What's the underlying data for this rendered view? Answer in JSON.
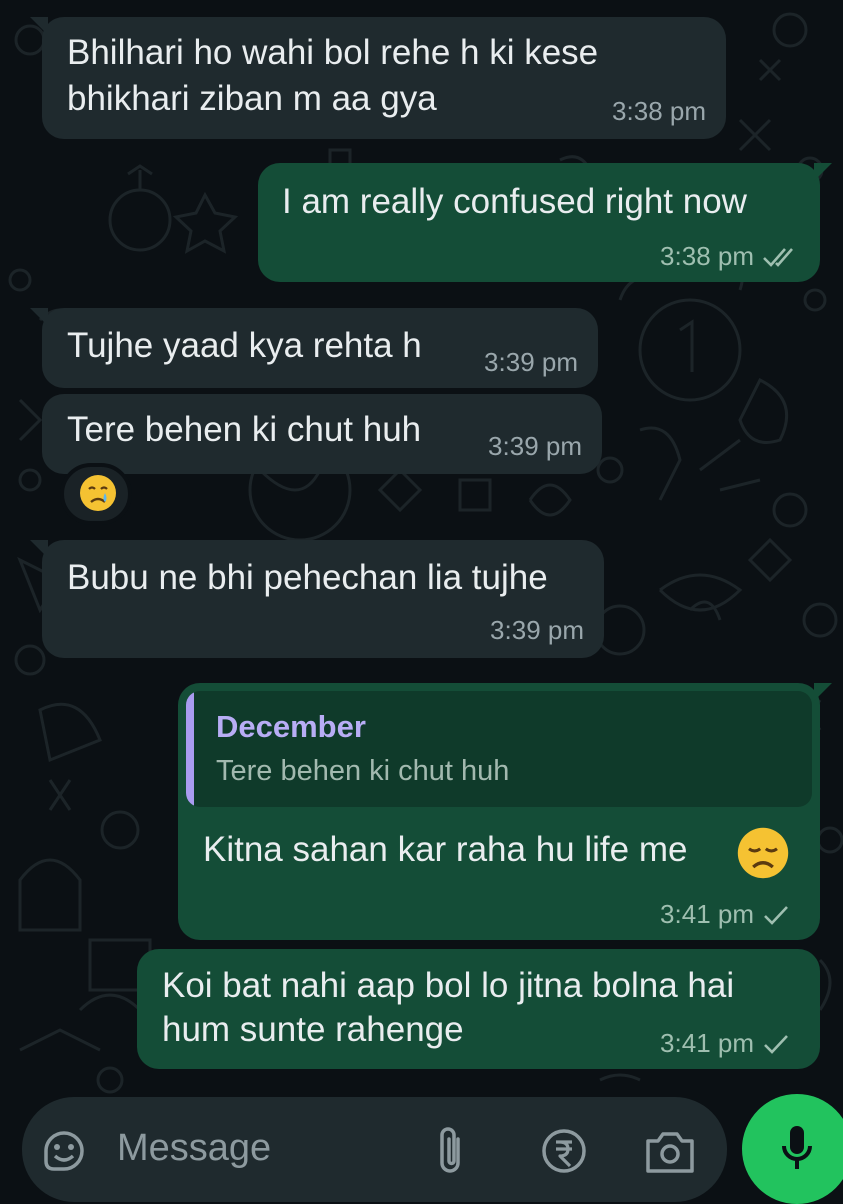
{
  "theme": {
    "bg": "#0b1014",
    "incoming_bubble": "#1f2a2e",
    "outgoing_bubble": "#144d37",
    "accent": "#22c35e",
    "quote_accent": "#a99cf0"
  },
  "messages": [
    {
      "direction": "incoming",
      "text_lines": [
        "Bhilhari ho wahi bol rehe h ki kese",
        "bhikhari ziban m aa gya"
      ],
      "time": "3:38 pm"
    },
    {
      "direction": "outgoing",
      "text": "I am really confused right now",
      "time": "3:38 pm",
      "status": "read"
    },
    {
      "direction": "incoming",
      "text": "Tujhe yaad kya rehta h",
      "time": "3:39 pm"
    },
    {
      "direction": "incoming",
      "text": "Tere behen ki chut huh",
      "time": "3:39 pm",
      "reaction": "crying-face-emoji"
    },
    {
      "direction": "incoming",
      "text": "Bubu ne bhi pehechan lia tujhe",
      "time": "3:39 pm"
    },
    {
      "direction": "outgoing",
      "reply_to": {
        "author": "December",
        "text": "Tere behen ki chut huh"
      },
      "text": "Kitna sahan kar raha hu life me",
      "emoji": "disappointed-face-emoji",
      "time": "3:41 pm",
      "status": "sent"
    },
    {
      "direction": "outgoing",
      "text_lines": [
        "Koi bat nahi aap bol lo jitna bolna hai",
        "hum sunte rahenge"
      ],
      "time": "3:41 pm",
      "status": "sent"
    }
  ],
  "composer": {
    "placeholder": "Message",
    "icons": [
      "sticker-icon",
      "paperclip-icon",
      "rupee-payment-icon",
      "camera-icon",
      "mic-icon"
    ]
  }
}
